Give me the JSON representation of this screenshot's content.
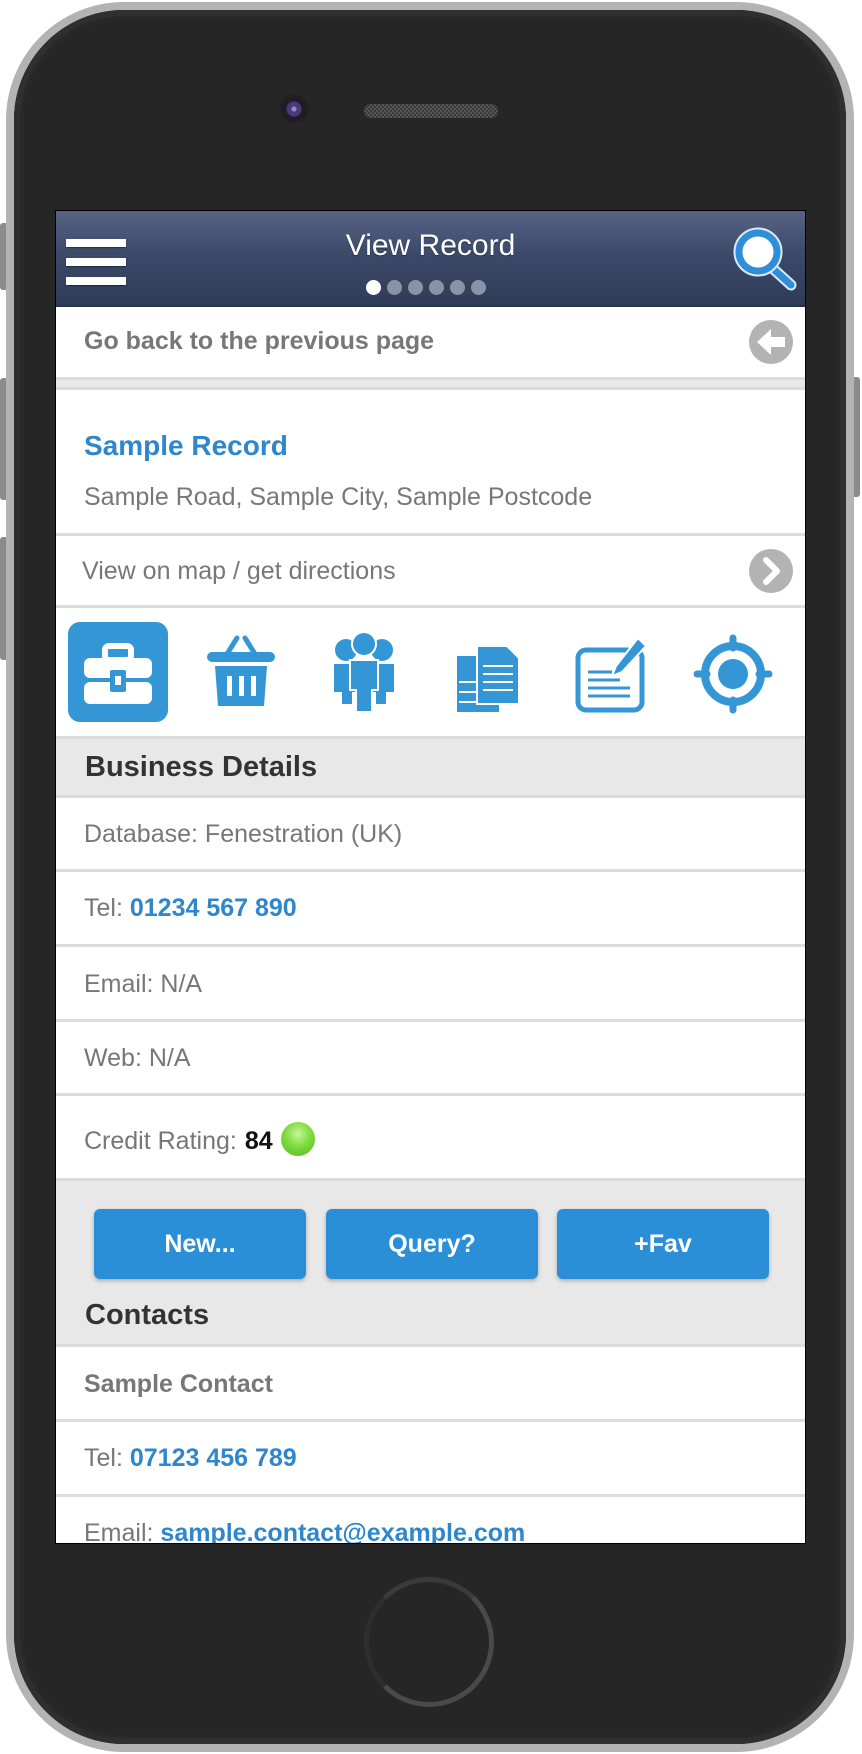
{
  "header": {
    "title": "View Record",
    "page_indicator": {
      "total": 6,
      "current": 1
    },
    "menu_icon": "hamburger-icon",
    "search_icon": "search-icon"
  },
  "back_row": {
    "label": "Go back to the previous page",
    "icon": "arrow-left-icon"
  },
  "record": {
    "name": "Sample Record",
    "address": "Sample Road, Sample City, Sample Postcode",
    "map_link": "View on map / get directions",
    "map_icon": "chevron-right-icon"
  },
  "tabs": [
    {
      "icon": "briefcase-icon",
      "active": true
    },
    {
      "icon": "basket-icon",
      "active": false
    },
    {
      "icon": "people-icon",
      "active": false
    },
    {
      "icon": "documents-icon",
      "active": false
    },
    {
      "icon": "edit-note-icon",
      "active": false
    },
    {
      "icon": "target-icon",
      "active": false
    }
  ],
  "business": {
    "title": "Business Details",
    "database_label": "Database:",
    "database_value": "Fenestration (UK)",
    "tel_label": "Tel:",
    "tel_value": "01234 567 890",
    "email_label": "Email:",
    "email_value": "N/A",
    "web_label": "Web:",
    "web_value": "N/A",
    "credit_label": "Credit Rating:",
    "credit_value": "84",
    "credit_status_color": "#5fd12a"
  },
  "actions": {
    "new_label": "New...",
    "query_label": "Query?",
    "fav_label": "+Fav"
  },
  "contacts": {
    "title": "Contacts",
    "items": [
      {
        "name": "Sample Contact",
        "tel_label": "Tel:",
        "tel_value": "07123 456 789",
        "email_label": "Email:",
        "email_value": "sample.contact@example.com"
      }
    ]
  },
  "colors": {
    "accent": "#2e86cc",
    "button": "#2b8fd8",
    "header_top": "#566385",
    "header_bottom": "#2f3c58"
  }
}
